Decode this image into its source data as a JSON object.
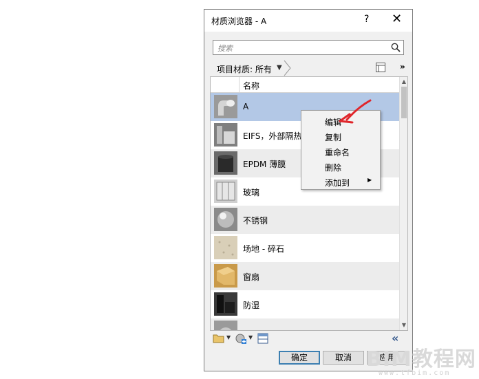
{
  "window": {
    "title": "材质浏览器 - A",
    "help": "?",
    "close": "✕"
  },
  "search": {
    "placeholder": "搜索"
  },
  "filter": {
    "label": "项目材质: 所有",
    "more": "»"
  },
  "list": {
    "header": "名称",
    "rows": [
      {
        "label": "A",
        "state": "selected"
      },
      {
        "label": "EIFS，外部隔热"
      },
      {
        "label": "EPDM 薄膜"
      },
      {
        "label": "玻璃"
      },
      {
        "label": "不锈钢"
      },
      {
        "label": "场地 - 碎石"
      },
      {
        "label": "窗扇"
      },
      {
        "label": "防湿"
      }
    ]
  },
  "context_menu": {
    "items": [
      "编辑",
      "复制",
      "重命名",
      "删除",
      "添加到"
    ]
  },
  "buttons": {
    "ok": "确定",
    "cancel": "取消",
    "apply": "应用"
  },
  "watermark": {
    "brand": "BIM教程网",
    "url": "www.tfbim.com"
  },
  "colors": {
    "selection": "#b3c8e6",
    "default_button_border": "#3c7fb1",
    "annotation_arrow": "#e0262b"
  }
}
